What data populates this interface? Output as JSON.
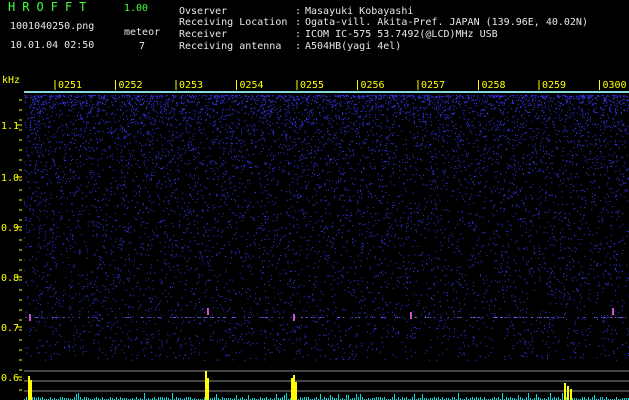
{
  "header": {
    "app_title": "HROFFT",
    "app_version": "1.00",
    "filename": "1001040250.png",
    "datetime": "10.01.04 02:50",
    "meteor_label": "meteor",
    "meteor_count": "7"
  },
  "info": [
    {
      "label": "Ovserver",
      "value": "Masayuki Kobayashi"
    },
    {
      "label": "Receiving Location",
      "value": "Ogata-vill. Akita-Pref. JAPAN (139.96E, 40.02N)"
    },
    {
      "label": "Receiver",
      "value": "ICOM IC-575 53.7492(@LCD)MHz USB"
    },
    {
      "label": "Receiving antenna",
      "value": "A504HB(yagi 4el)"
    }
  ],
  "spectrogram": {
    "freq_unit": "kHz",
    "freq_ticks": [
      "1.1",
      "1.0",
      "0.9",
      "0.8",
      "0.7",
      "0.6"
    ],
    "time_ticks": [
      "0251",
      "0252",
      "0253",
      "0254",
      "0255",
      "0256",
      "0257",
      "0258",
      "0259",
      "0300"
    ],
    "colors": {
      "tick_text": "#ffff00",
      "background": "#000000",
      "noise": "#3a3aff",
      "carrier": "#9fffff",
      "meteor_bar": "#ffff00",
      "noise_floor": "#00e0e0"
    }
  }
}
